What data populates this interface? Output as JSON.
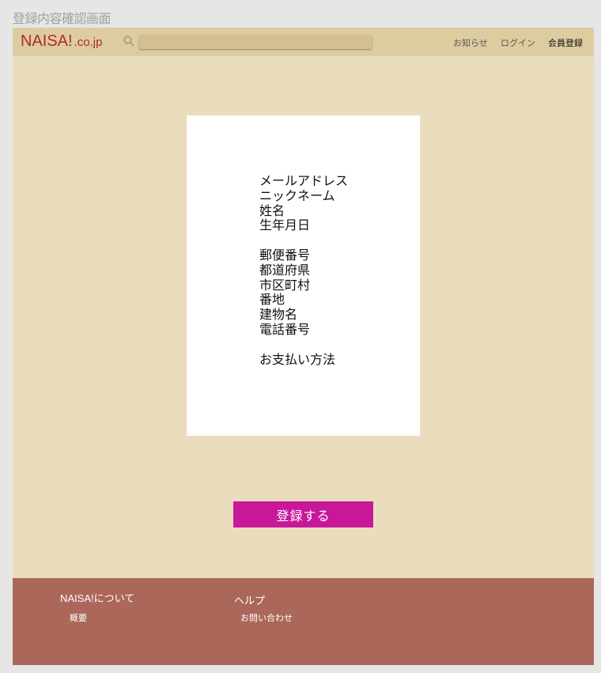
{
  "screen_title": "登録内容確認画面",
  "header": {
    "logo_main": "NAISA!",
    "logo_tld": ".co.jp",
    "search_value": "",
    "nav": [
      "お知らせ",
      "ログイン",
      "会員登録"
    ]
  },
  "confirmation": {
    "group_account": [
      "メールアドレス",
      "ニックネーム",
      "姓名",
      "生年月日"
    ],
    "group_address": [
      "郵便番号",
      "都道府県",
      "市区町村",
      "番地",
      "建物名",
      "電話番号"
    ],
    "group_payment": [
      "お支払い方法"
    ]
  },
  "submit_label": "登録する",
  "footer": {
    "about_heading": "NAISA!について",
    "about_link": "概要",
    "help_heading": "ヘルプ",
    "help_link": "お問い合わせ"
  },
  "colors": {
    "background": "#e9ddbd",
    "header": "#ddcca0",
    "brand": "#b02a2a",
    "primary_button": "#c8189a",
    "footer": "#ab675a"
  },
  "icons": [
    "search-icon"
  ]
}
